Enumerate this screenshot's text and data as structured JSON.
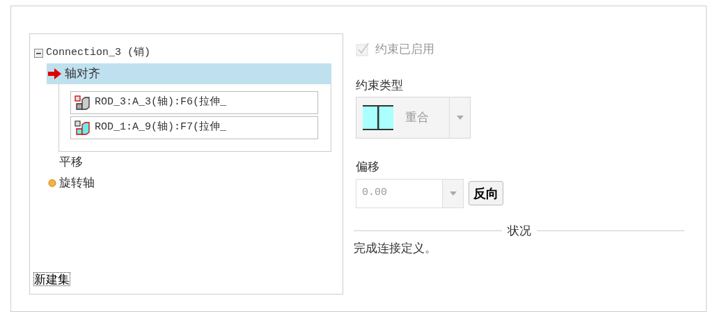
{
  "tree": {
    "label": "Connection_3 (销)",
    "expanded": true,
    "items": [
      {
        "kind": "constraint",
        "label": "轴对齐",
        "selected": true,
        "children": [
          {
            "label": "ROD_3:A_3(轴):F6(拉伸_",
            "kind": "first"
          },
          {
            "label": "ROD_1:A_9(轴):F7(拉伸_",
            "kind": "second"
          }
        ]
      },
      {
        "kind": "plain",
        "label": "平移",
        "selected": false
      },
      {
        "kind": "status",
        "label": "旋转轴",
        "selected": false
      }
    ]
  },
  "new_set_button": "新建集",
  "constraint_enabled": {
    "label": "约束已启用",
    "checked": true,
    "disabled": true
  },
  "constraint_type": {
    "label": "约束类型",
    "value": "重合"
  },
  "offset": {
    "label": "偏移",
    "value": "0.00",
    "button": "反向"
  },
  "status": {
    "title": "状况",
    "message": "完成连接定义。"
  }
}
